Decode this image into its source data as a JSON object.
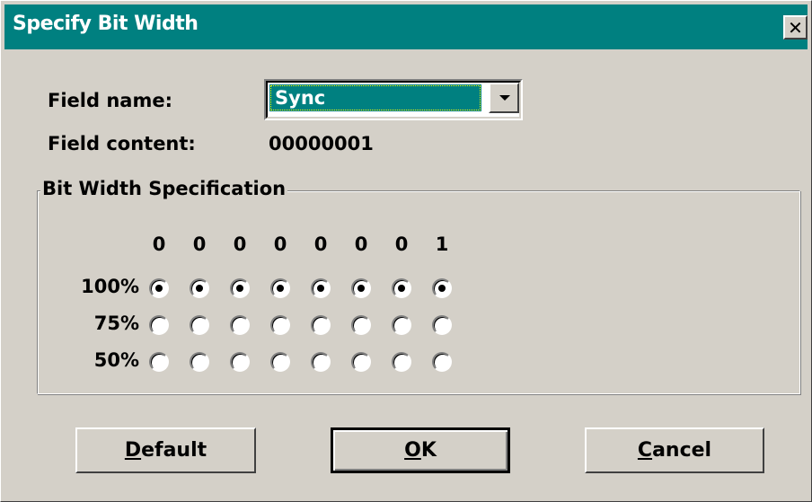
{
  "window": {
    "title": "Specify Bit Width",
    "close_glyph": "✕"
  },
  "field_name": {
    "label": "Field name:",
    "value": "Sync"
  },
  "field_content": {
    "label": "Field content:",
    "value": "00000001"
  },
  "group": {
    "title": "Bit Width Specification",
    "bits": [
      "0",
      "0",
      "0",
      "0",
      "0",
      "0",
      "0",
      "1"
    ],
    "rows": [
      {
        "label": "100%",
        "selected": [
          true,
          true,
          true,
          true,
          true,
          true,
          true,
          true
        ]
      },
      {
        "label": "75%",
        "selected": [
          false,
          false,
          false,
          false,
          false,
          false,
          false,
          false
        ]
      },
      {
        "label": "50%",
        "selected": [
          false,
          false,
          false,
          false,
          false,
          false,
          false,
          false
        ]
      }
    ]
  },
  "buttons": {
    "default": {
      "mnemonic": "D",
      "rest": "efault"
    },
    "ok": {
      "mnemonic": "O",
      "rest": "K"
    },
    "cancel": {
      "mnemonic": "C",
      "rest": "ancel"
    }
  },
  "colors": {
    "titlebar": "#008080",
    "face": "#d4d0c8",
    "selection": "#008080"
  }
}
